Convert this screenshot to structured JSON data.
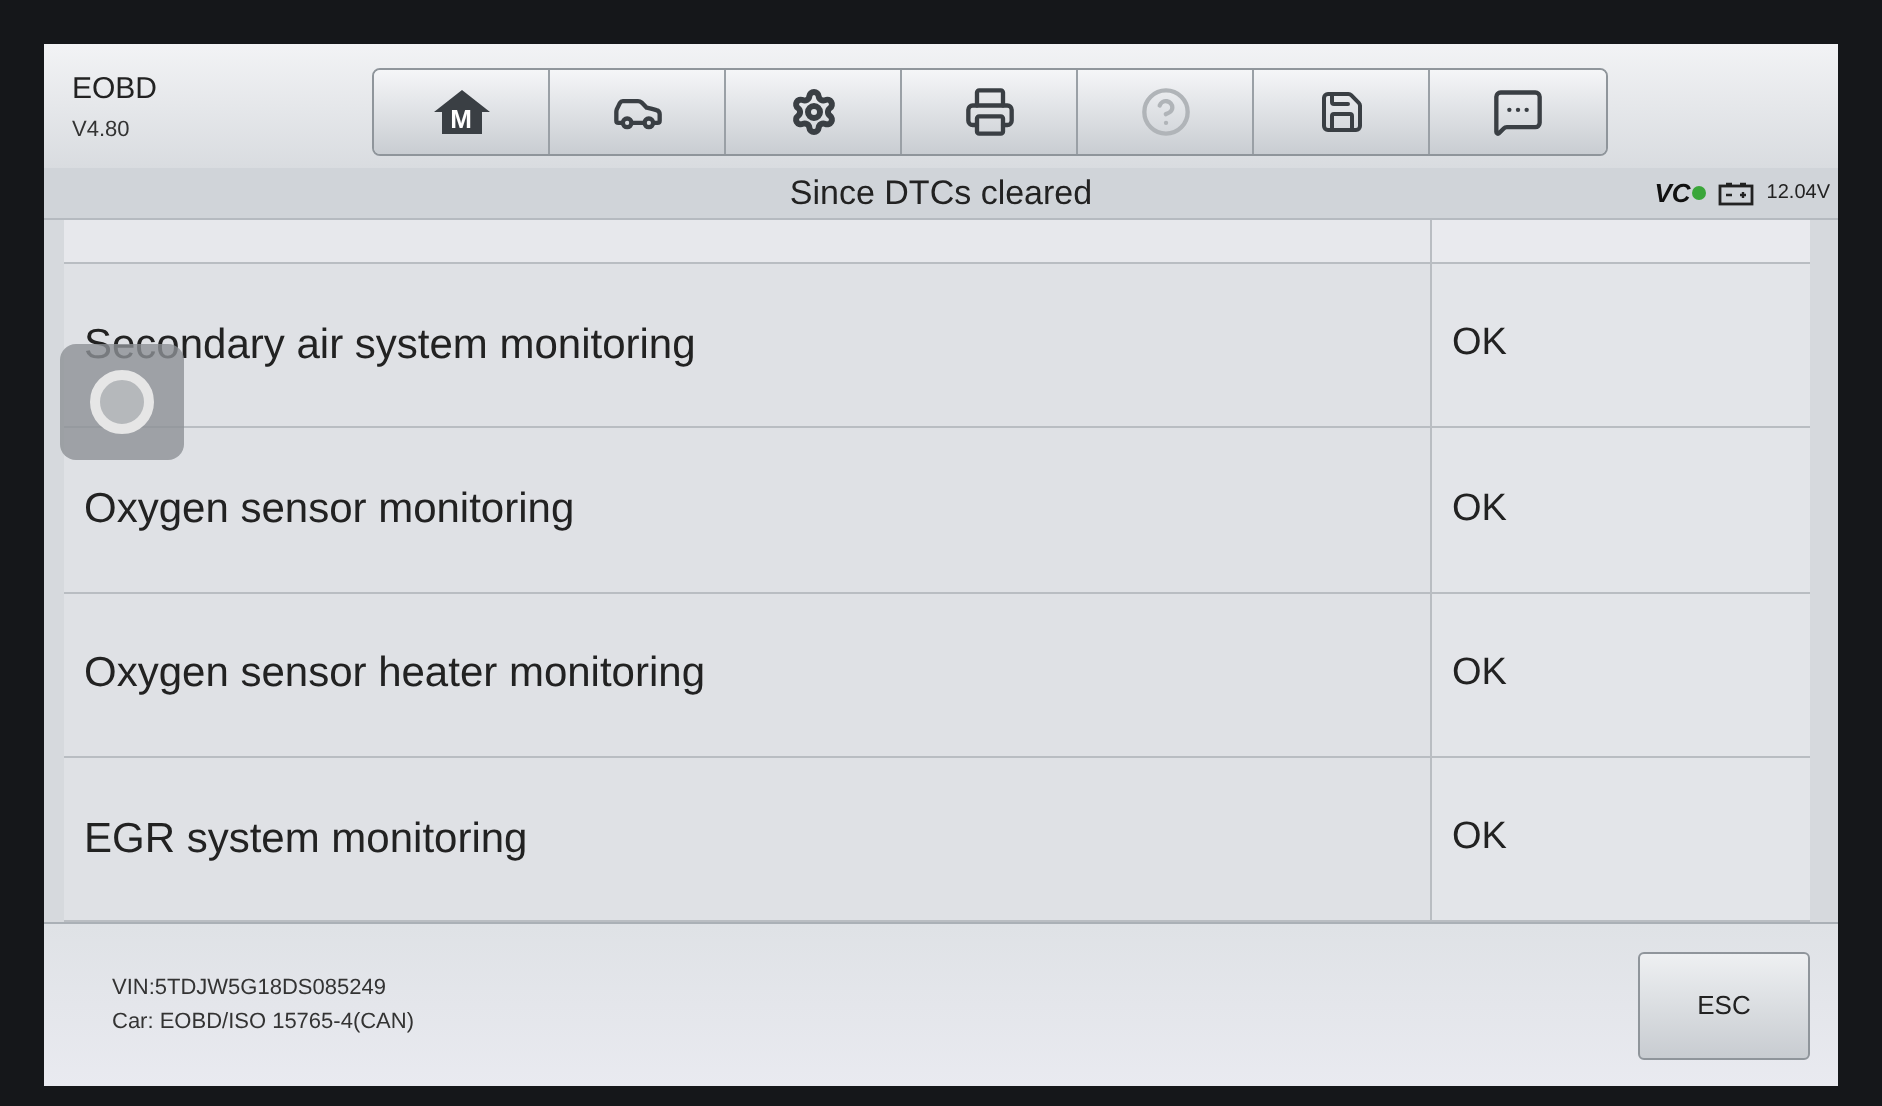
{
  "app": {
    "name": "EOBD",
    "version": "V4.80"
  },
  "toolbar": [
    {
      "kind": "home",
      "label": "M",
      "disabled": false
    },
    {
      "kind": "vehicle",
      "disabled": false
    },
    {
      "kind": "settings",
      "disabled": false
    },
    {
      "kind": "print",
      "disabled": false
    },
    {
      "kind": "help",
      "disabled": true
    },
    {
      "kind": "save",
      "disabled": false
    },
    {
      "kind": "message",
      "disabled": false
    }
  ],
  "subheader": {
    "title": "Since DTCs cleared",
    "vci": {
      "label": "VC",
      "connected": true
    },
    "voltage": "12.04V"
  },
  "table": {
    "rows": [
      {
        "name": "Secondary air system monitoring",
        "status": "OK"
      },
      {
        "name": "Oxygen sensor monitoring",
        "status": "OK"
      },
      {
        "name": "Oxygen sensor heater monitoring",
        "status": "OK"
      },
      {
        "name": "EGR system monitoring",
        "status": "OK"
      }
    ]
  },
  "footer": {
    "vin": "VIN:5TDJW5G18DS085249",
    "car": "Car: EOBD/ISO 15765-4(CAN)",
    "button": "ESC"
  }
}
